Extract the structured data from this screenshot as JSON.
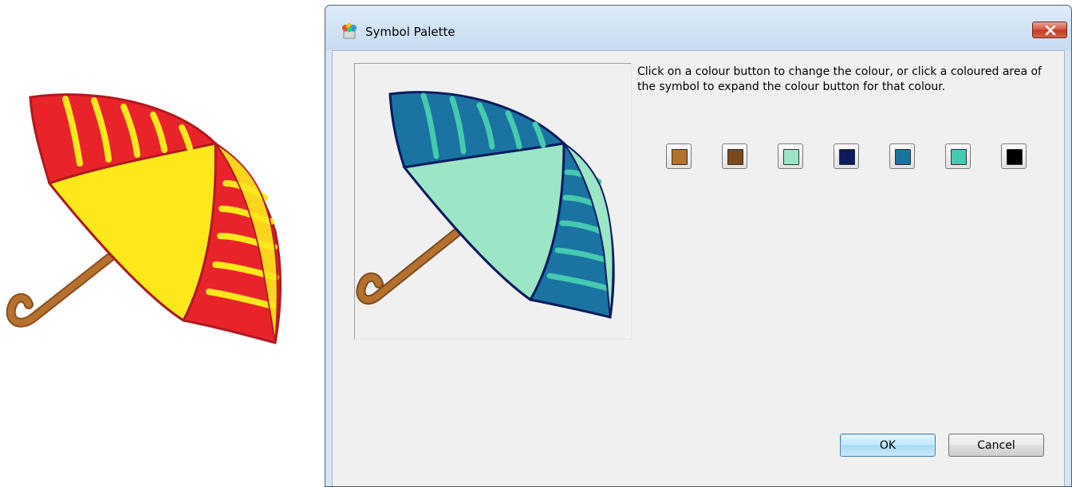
{
  "window": {
    "title": "Symbol Palette"
  },
  "instructions": "Click on a colour button to change the colour, or click a coloured area of the symbol to expand the colour button for that colour.",
  "swatches": [
    {
      "color": "#b5712f"
    },
    {
      "color": "#7a4a1e"
    },
    {
      "color": "#9ce5c7"
    },
    {
      "color": "#0d1a5c"
    },
    {
      "color": "#1a73a0"
    },
    {
      "color": "#45c9b0"
    },
    {
      "color": "#000000"
    }
  ],
  "buttons": {
    "ok_label": "OK",
    "cancel_label": "Cancel"
  },
  "icons": {
    "app": "symbol-palette-app-icon",
    "close": "close-icon"
  },
  "colors": {
    "original_umbrella": [
      "#e8242a",
      "#fde81c",
      "#b5712f"
    ],
    "recoloured_umbrella": [
      "#1a73a0",
      "#45c9b0",
      "#9ce5c7",
      "#0d1a5c",
      "#b5712f"
    ]
  }
}
